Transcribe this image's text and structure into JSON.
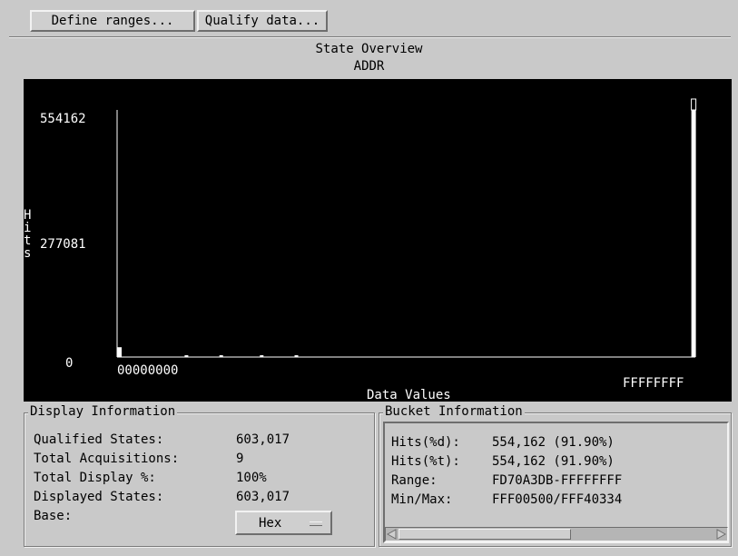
{
  "toolbar": {
    "define_ranges_label": "Define ranges...",
    "qualify_data_label": "Qualify data..."
  },
  "overview": {
    "title": "State Overview",
    "label_name": "ADDR"
  },
  "chart_data": {
    "type": "bar",
    "ylabel": "Hits",
    "xlabel": "Data Values",
    "ylim": [
      0,
      554162
    ],
    "yticks": [
      "554162",
      "277081",
      "0"
    ],
    "x_start_label": "00000000",
    "x_end_label": "FFFFFFFF",
    "bars": [
      {
        "position": 0.0,
        "value": 22000
      },
      {
        "position": 0.12,
        "value": 1500
      },
      {
        "position": 0.18,
        "value": 1500
      },
      {
        "position": 0.25,
        "value": 1500
      },
      {
        "position": 0.31,
        "value": 1500
      },
      {
        "position": 0.997,
        "value": 554162
      }
    ]
  },
  "display_info": {
    "title": "Display Information",
    "rows": [
      {
        "label": "Qualified States:",
        "value": "603,017"
      },
      {
        "label": "Total Acquisitions:",
        "value": "9"
      },
      {
        "label": "Total Display %:",
        "value": "100%"
      },
      {
        "label": "Displayed States:",
        "value": "603,017"
      },
      {
        "label": "Base:",
        "value": ""
      }
    ],
    "base_value": "Hex"
  },
  "bucket_info": {
    "title": "Bucket Information",
    "rows": [
      {
        "label": "Hits(%d):",
        "value": "554,162 (91.90%)"
      },
      {
        "label": "Hits(%t):",
        "value": "554,162 (91.90%)"
      },
      {
        "label": "Range:",
        "value": "FD70A3DB-FFFFFFFF"
      },
      {
        "label": "Min/Max:",
        "value": "FFF00500/FFF40334"
      }
    ]
  },
  "colors": {
    "background": "#c9c9c9",
    "plot_background": "#000000",
    "plot_foreground": "#ffffff"
  }
}
